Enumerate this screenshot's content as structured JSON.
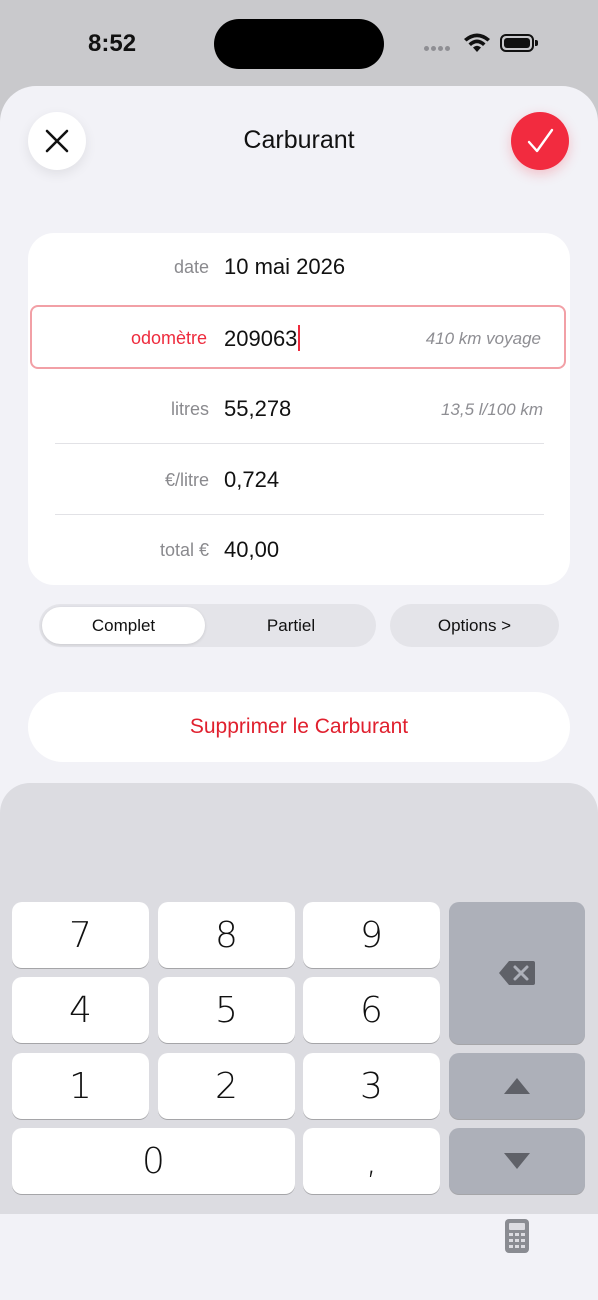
{
  "status_bar": {
    "time": "8:52"
  },
  "header": {
    "title": "Carburant",
    "close_icon": "x-mark-icon",
    "confirm_icon": "checkmark-icon",
    "accent_color": "#f22b3f"
  },
  "form": {
    "date": {
      "label": "date",
      "value": "10 mai 2026"
    },
    "odometer": {
      "label": "odomètre",
      "value": "209063",
      "hint": "410 km voyage"
    },
    "litres": {
      "label": "litres",
      "value": "55,278",
      "hint": "13,5 l/100 km"
    },
    "price_per_litre": {
      "label": "€/litre",
      "value": "0,724"
    },
    "total": {
      "label": "total €",
      "value": "40,00"
    }
  },
  "segment": {
    "options": [
      "Complet",
      "Partiel"
    ],
    "selected": "Complet"
  },
  "options_button": "Options >",
  "delete_button": "Supprimer le Carburant",
  "keypad": {
    "keys": [
      "7",
      "8",
      "9",
      "4",
      "5",
      "6",
      "1",
      "2",
      "3",
      "0",
      ","
    ],
    "side_keys": [
      "backspace-icon",
      "arrow-up-icon",
      "arrow-down-icon"
    ],
    "calculator_icon": "calculator-icon"
  }
}
